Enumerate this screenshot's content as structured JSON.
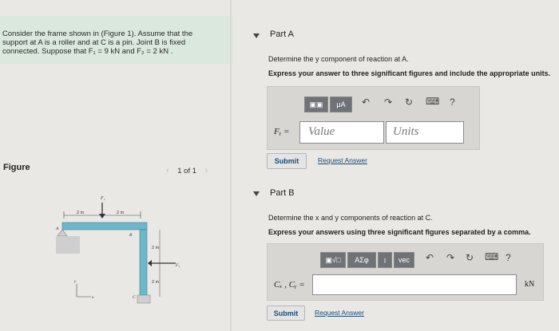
{
  "problem": {
    "text_lines": [
      "Consider the frame shown in (Figure 1). Assume that the",
      "support at A is a roller and at C is a pin. Joint B is fixed",
      "connected. Suppose that F₁ = 9 kN and F₂ = 2 kN ."
    ]
  },
  "figure": {
    "label": "Figure",
    "pager": "1 of 1",
    "labels": {
      "f1": "F₁",
      "f2": "F₂",
      "dim_left": "2 m",
      "dim_right": "2 m",
      "dim_upper": "2 m",
      "dim_lower": "2 m",
      "a": "A",
      "b": "B",
      "c": "C",
      "y": "y",
      "x": "x"
    }
  },
  "part_a": {
    "title": "Part A",
    "question": "Determine the y component of reaction at A.",
    "instruction": "Express your answer to three significant figures and include the appropriate units.",
    "toolbar": {
      "templates": "▣▣",
      "mu_a": "μA",
      "undo": "↶",
      "redo": "↷",
      "reset": "↻",
      "keyboard": "⌨",
      "help": "?"
    },
    "var_label": "Fᵧ =",
    "value_placeholder": "Value",
    "units_placeholder": "Units",
    "submit": "Submit",
    "request_answer": "Request Answer"
  },
  "part_b": {
    "title": "Part B",
    "question": "Determine the x and y components of reaction at C.",
    "instruction": "Express your answers using three significant figures separated by a comma.",
    "toolbar": {
      "templates": "▣√□",
      "greek": "AΣφ",
      "arrows": "↕",
      "vec": "vec",
      "undo": "↶",
      "redo": "↷",
      "reset": "↻",
      "keyboard": "⌨",
      "help": "?"
    },
    "var_label": "Cₓ , Cᵧ =",
    "unit": "kN",
    "submit": "Submit",
    "request_answer": "Request Answer"
  }
}
